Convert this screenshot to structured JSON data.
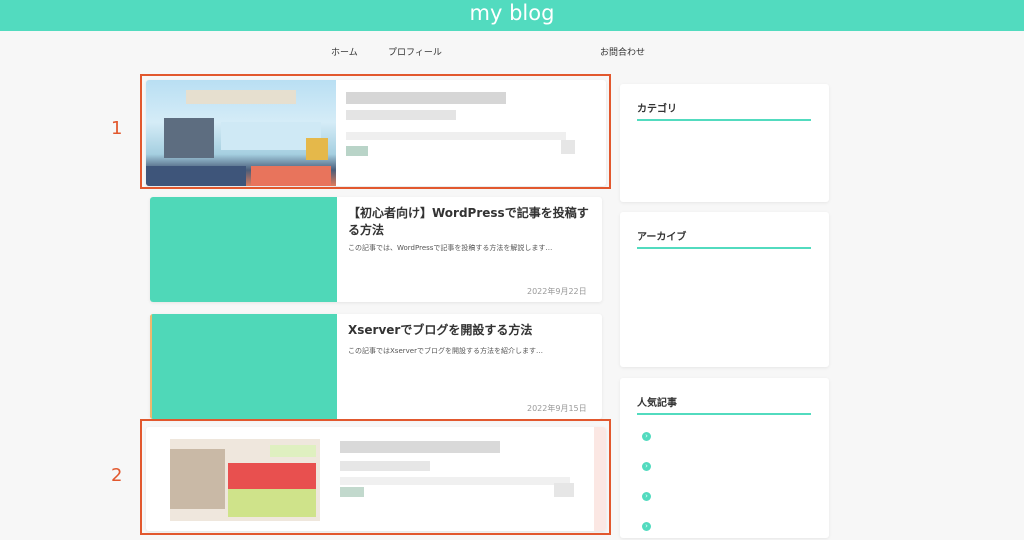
{
  "header": {
    "site_title": "my blog",
    "background_color": "#52dbbf"
  },
  "nav": {
    "items": [
      {
        "label": "ホーム"
      },
      {
        "label": "プロフィール"
      },
      {
        "label": "お問合わせ"
      }
    ]
  },
  "posts": [
    {
      "title": "【初心者向け】WordPressで記事を投稿する方法",
      "excerpt": "この記事では、WordPressで記事を投稿する方法を解説します…",
      "date": "2022年9月22日"
    },
    {
      "title": "Xserverでブログを開設する方法",
      "excerpt": "この記事ではXserverでブログを開設する方法を紹介します…",
      "date": "2022年9月15日"
    }
  ],
  "annotations": [
    {
      "number": "1"
    },
    {
      "number": "2"
    }
  ],
  "sidebar": {
    "category_title": "カテゴリ",
    "archive_title": "アーカイブ",
    "popular_title": "人気記事",
    "bullet_icon": "chevron-right-icon"
  },
  "colors": {
    "accent": "#52dbbf",
    "annotation": "#e2582e"
  }
}
